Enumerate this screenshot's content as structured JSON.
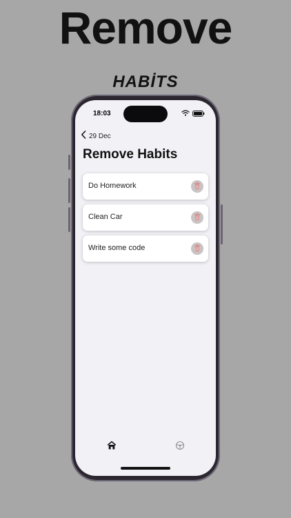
{
  "promo": {
    "headline": "Remove",
    "subheadline": "HABİTS"
  },
  "status_bar": {
    "time": "18:03",
    "wifi_icon": "wifi-icon",
    "battery_icon": "battery-icon"
  },
  "navigation": {
    "back_label": "29 Dec",
    "back_icon": "chevron-left-icon"
  },
  "main": {
    "title": "Remove Habits",
    "habits": [
      {
        "name": "Do Homework",
        "action_icon": "trash-icon"
      },
      {
        "name": "Clean Car",
        "action_icon": "trash-icon"
      },
      {
        "name": "Write some code",
        "action_icon": "trash-icon"
      }
    ]
  },
  "tab_bar": {
    "home_icon": "house-icon",
    "settings_icon": "steering-wheel-icon"
  },
  "colors": {
    "background": "#a7a7a7",
    "screen": "#f2f1f6",
    "card": "#ffffff",
    "delete_button": "#c9c3c3",
    "delete_icon": "#d98c8c"
  }
}
